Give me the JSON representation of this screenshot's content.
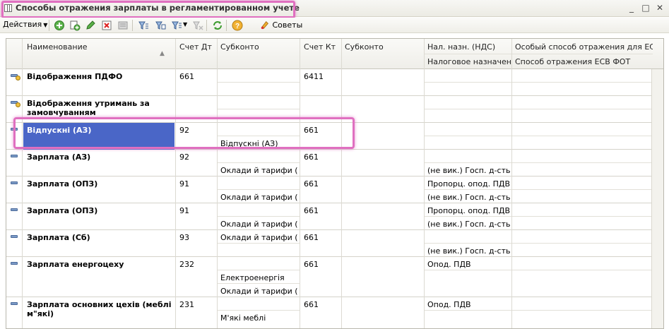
{
  "window": {
    "title": "Способы отражения зарплаты в регламентированном учете",
    "controls": [
      "_",
      "□",
      "✕"
    ]
  },
  "toolbar": {
    "actions_label": "Действия",
    "advice_label": "Советы",
    "icons": [
      "add-icon",
      "copy-icon",
      "edit-icon",
      "delete-icon",
      "post-icon",
      "filter-icon",
      "filter-value-icon",
      "filter-settings-icon",
      "clear-filter-icon",
      "refresh-icon",
      "help-icon",
      "advice-icon"
    ]
  },
  "table": {
    "headers": {
      "name": "Наименование",
      "debit": "Счет Дт",
      "subconto1": "Субконто",
      "credit": "Счет Кт",
      "subconto2": "Субконто",
      "vat_top": "Нал. назн. (НДС)",
      "vat_bottom": "Налоговое назначен...",
      "esv_top": "Особый способ отражения для ЕС...",
      "esv_bottom": "Способ отражения ЕСВ ФОТ"
    },
    "rows": [
      {
        "name": "Відображення ПДФО",
        "debit": "661",
        "sub1_a": "",
        "sub1_b": "",
        "credit": "6411",
        "vat_a": "",
        "vat_b": "",
        "folder": true
      },
      {
        "name": "Відображення утримань за замовчуванням",
        "debit": "",
        "sub1_a": "",
        "sub1_b": "",
        "credit": "",
        "vat_a": "",
        "vat_b": "",
        "folder": true
      },
      {
        "name": "Відпускні (АЗ)",
        "debit": "92",
        "sub1_a": "",
        "sub1_b": "Відпускні (АЗ)",
        "credit": "661",
        "vat_a": "",
        "vat_b": "",
        "folder": false
      },
      {
        "name": "Зарплата (АЗ)",
        "debit": "92",
        "sub1_a": "",
        "sub1_b": "Оклади й тарифи (А...",
        "credit": "661",
        "vat_a": "",
        "vat_b": "(не вик.) Госп. д-сть",
        "folder": false
      },
      {
        "name": "Зарплата (ОПЗ)",
        "debit": "91",
        "sub1_a": "",
        "sub1_b": "Оклади й тарифи (...",
        "credit": "661",
        "vat_a": "Пропорц. опод. ПДВ",
        "vat_b": "(не вик.) Госп. д-сть",
        "folder": false
      },
      {
        "name": "Зарплата (ОПЗ)",
        "debit": "91",
        "sub1_a": "",
        "sub1_b": "Оклади й тарифи (...",
        "credit": "661",
        "vat_a": "Пропорц. опод. ПДВ",
        "vat_b": "(не вик.) Госп. д-сть",
        "folder": false
      },
      {
        "name": "Зарплата (Сб)",
        "debit": "93",
        "sub1_a": "Оклади й тарифи (Сб)",
        "sub1_b": "",
        "credit": "661",
        "vat_a": "",
        "vat_b": "(не вик.) Госп. д-сть",
        "folder": false
      },
      {
        "name": "Зарплата енергоцеху",
        "debit": "232",
        "sub1_a": "",
        "sub1_b": "Електроенергія",
        "sub1_c": "Оклади й тарифи (...",
        "credit": "661",
        "vat_a": "Опод. ПДВ",
        "vat_b": "",
        "folder": false
      },
      {
        "name": "Зарплата основних цехів (меблі м\"які)",
        "debit": "231",
        "sub1_a": "",
        "sub1_b": "М'які меблі",
        "credit": "661",
        "vat_a": "Опод. ПДВ",
        "vat_b": "",
        "folder": false
      }
    ]
  }
}
